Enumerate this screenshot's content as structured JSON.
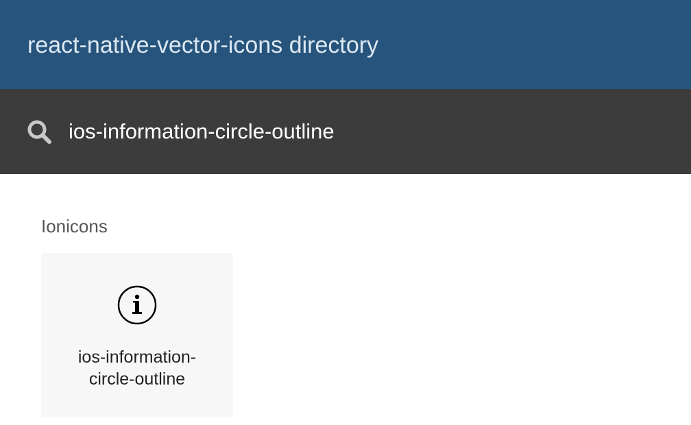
{
  "header": {
    "title": "react-native-vector-icons directory"
  },
  "search": {
    "icon": "search-icon",
    "value": "ios-information-circle-outline"
  },
  "results": {
    "families": [
      {
        "name": "Ionicons",
        "icons": [
          {
            "glyph": "information-circle-outline-icon",
            "name_line1": "ios-information-",
            "name_line2": "circle-outline"
          }
        ]
      }
    ]
  },
  "colors": {
    "header_bg": "#26547c",
    "search_bg": "#3c3c3c",
    "card_bg": "#f7f7f7"
  }
}
